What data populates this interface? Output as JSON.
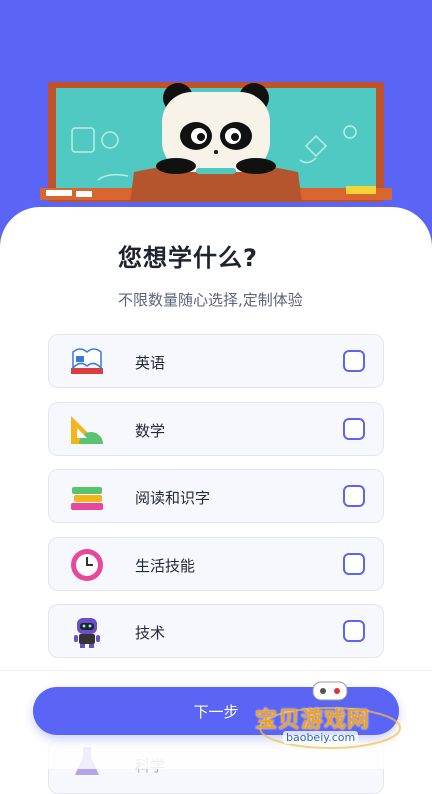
{
  "colors": {
    "accent": "#5a64f5",
    "chalkboard": "#4fc9c2",
    "frame": "#c0522a"
  },
  "page": {
    "title": "您想学什么?",
    "subtitle": "不限数量随心选择,定制体验"
  },
  "options": [
    {
      "label": "英语",
      "icon": "book-icon",
      "checked": false
    },
    {
      "label": "数学",
      "icon": "ruler-protractor-icon",
      "checked": false
    },
    {
      "label": "阅读和识字",
      "icon": "stacked-books-icon",
      "checked": false
    },
    {
      "label": "生活技能",
      "icon": "clock-icon",
      "checked": false
    },
    {
      "label": "技术",
      "icon": "robot-icon",
      "checked": false
    }
  ],
  "partial_option": {
    "label": "科学",
    "icon": "flask-icon"
  },
  "footer": {
    "next_label": "下一步"
  },
  "watermark": {
    "text": "宝贝游戏网",
    "url": "baobeiy.com"
  }
}
